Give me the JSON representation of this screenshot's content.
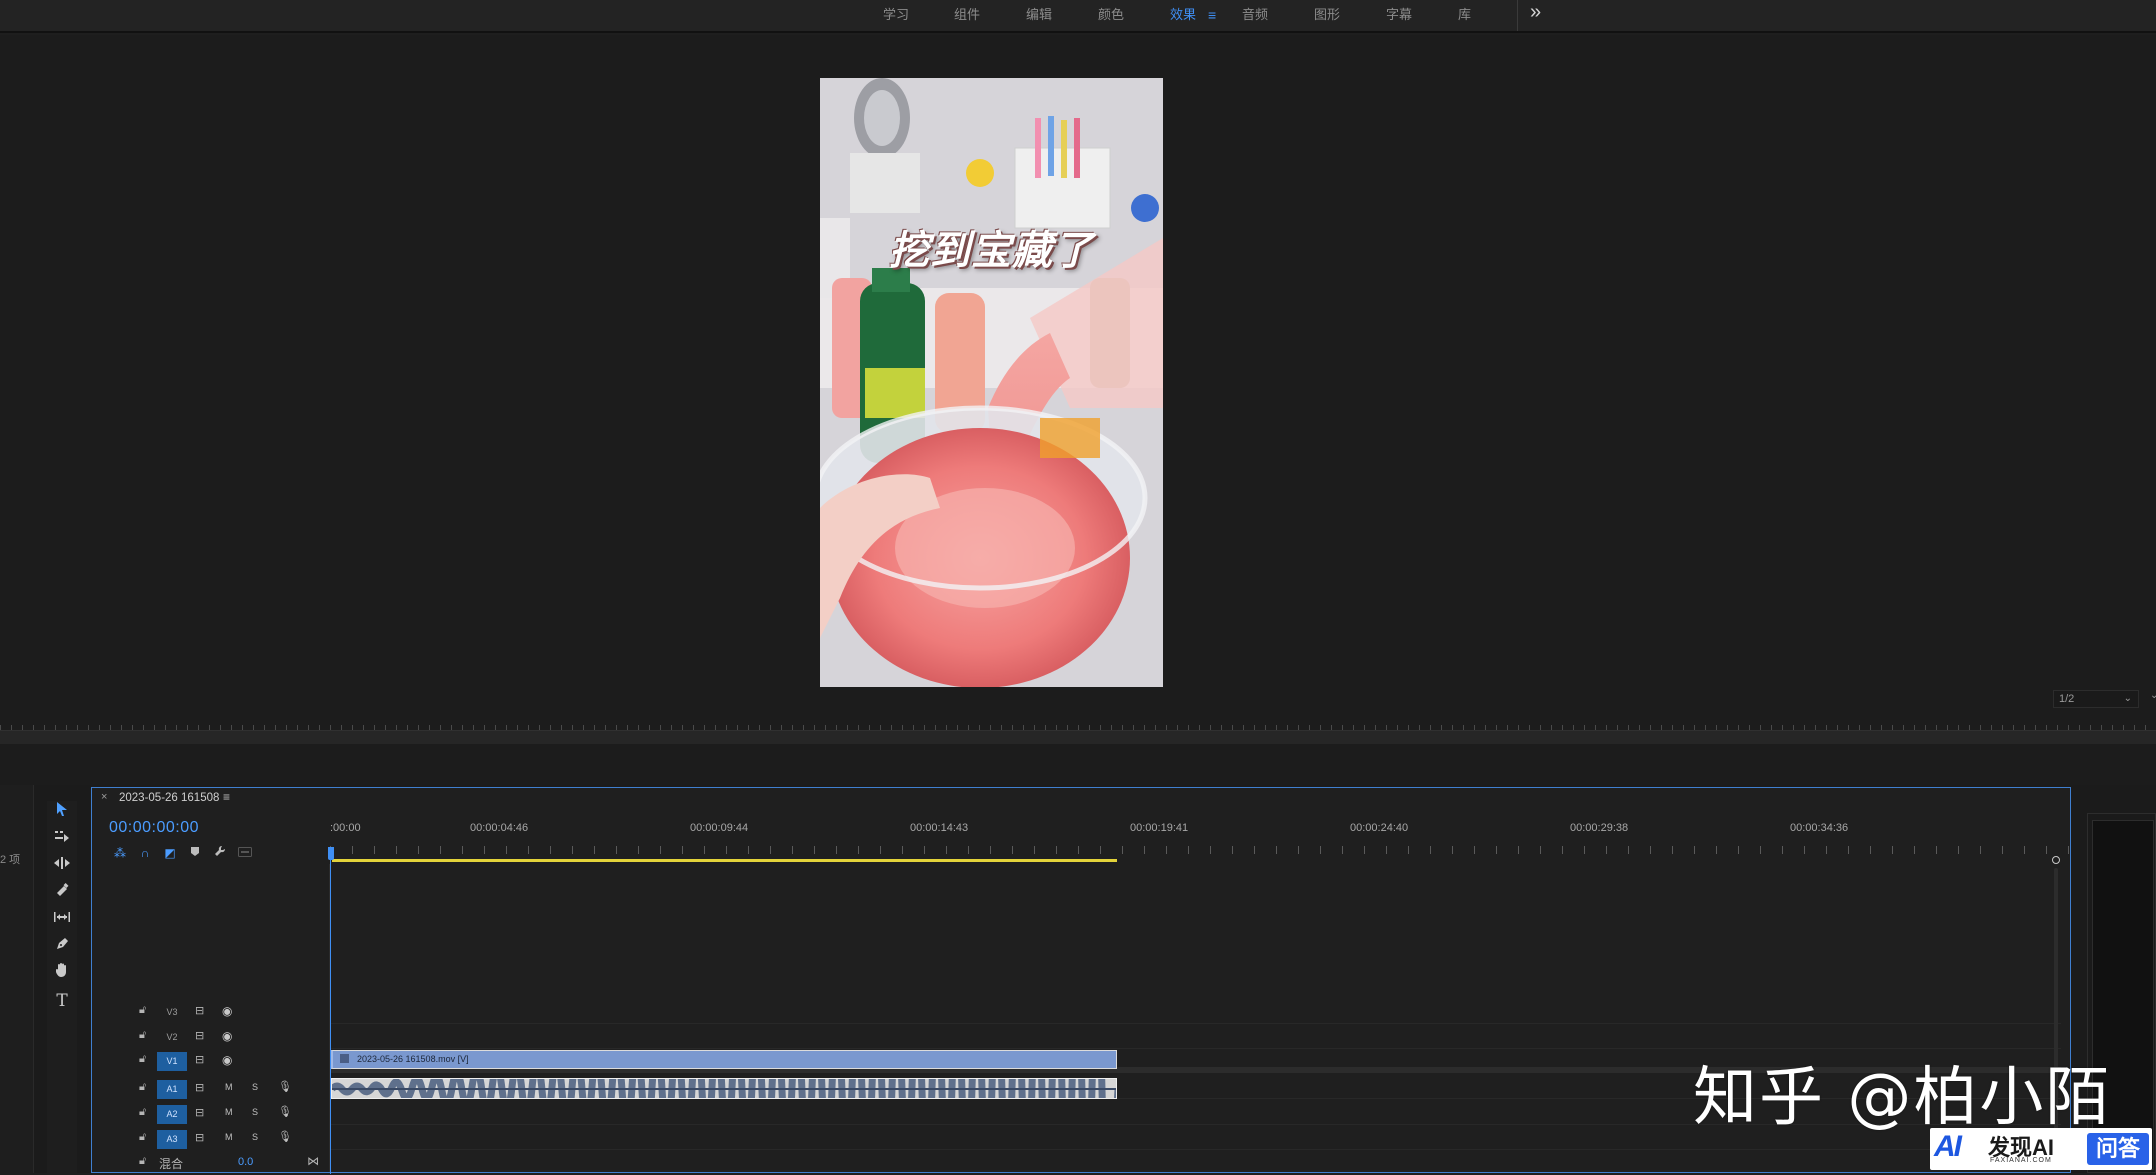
{
  "workspaces": [
    {
      "label": "学习",
      "active": false
    },
    {
      "label": "组件",
      "active": false
    },
    {
      "label": "编辑",
      "active": false
    },
    {
      "label": "颜色",
      "active": false
    },
    {
      "label": "效果",
      "active": true
    },
    {
      "label": "音频",
      "active": false
    },
    {
      "label": "图形",
      "active": false
    },
    {
      "label": "字幕",
      "active": false
    },
    {
      "label": "库",
      "active": false
    }
  ],
  "workspace_menu_icon": "≡",
  "workspace_overflow_icon": "»",
  "program": {
    "caption": "挖到宝藏了",
    "zoom": "1/2"
  },
  "project": {
    "item_count": "2 项"
  },
  "timeline": {
    "sequence_name": "2023-05-26 161508",
    "timecode": "00:00:00:00",
    "ruler_labels": [
      ":00:00",
      "00:00:04:46",
      "00:00:09:44",
      "00:00:14:43",
      "00:00:19:41",
      "00:00:24:40",
      "00:00:29:38",
      "00:00:34:36"
    ],
    "tracks": {
      "v3": "V3",
      "v2": "V2",
      "v1": "V1",
      "a1": "A1",
      "a2": "A2",
      "a3": "A3",
      "m": "M",
      "s": "S"
    },
    "mix_label": "混合",
    "mix_value": "0.0",
    "video_clip_name": "2023-05-26 161508.mov [V]"
  },
  "watermark": {
    "zhihu": "知乎 @柏小陌",
    "faxian_logo": "AI",
    "faxian_title": "发现AI",
    "faxian_sub": "FAXIANAI.COM",
    "faxian_qa": "问答"
  },
  "colors": {
    "accent": "#3f8ff4",
    "workarea": "#e3d33a",
    "clip_video": "#7a98cf"
  }
}
